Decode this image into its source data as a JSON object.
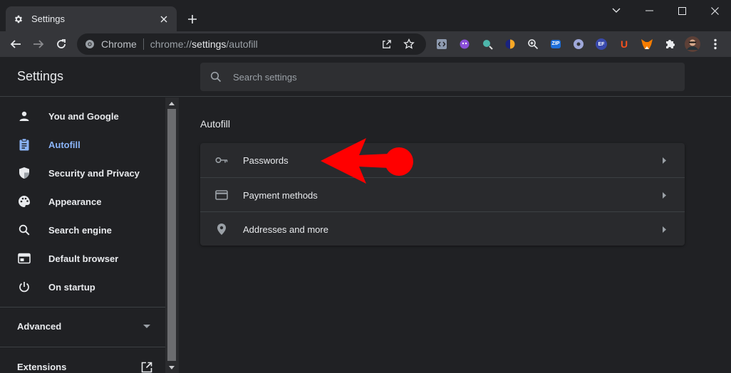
{
  "tab": {
    "title": "Settings"
  },
  "omnibox": {
    "site_label": "Chrome",
    "url_prefix": "chrome://",
    "url_host": "settings",
    "url_path": "/autofill"
  },
  "extensions": [
    {
      "name": "dev-tools-extension-icon",
      "color": "#8e9aaf"
    },
    {
      "name": "purple-monster-extension-icon",
      "color": "#8a4fd8"
    },
    {
      "name": "magnifier-teal-extension-icon",
      "color": "#4db6ac"
    },
    {
      "name": "half-moon-extension-icon",
      "color": "#f9a825"
    },
    {
      "name": "zoom-extension-icon",
      "color": "#e8eaed"
    },
    {
      "name": "zip-extension-icon",
      "color": "#1e6fd9",
      "text": "ZIP"
    },
    {
      "name": "circle-extension-icon",
      "color": "#9fa8da"
    },
    {
      "name": "ef-extension-icon",
      "color": "#3949ab",
      "text": "EF"
    },
    {
      "name": "u-extension-icon",
      "color": "#f4511e",
      "text": "U"
    },
    {
      "name": "fox-extension-icon",
      "color": "#f57c00"
    }
  ],
  "settings": {
    "title": "Settings",
    "search_placeholder": "Search settings"
  },
  "sidebar": {
    "items": [
      {
        "label": "You and Google",
        "icon": "person-icon"
      },
      {
        "label": "Autofill",
        "icon": "clipboard-icon",
        "active": true
      },
      {
        "label": "Security and Privacy",
        "icon": "shield-icon"
      },
      {
        "label": "Appearance",
        "icon": "palette-icon"
      },
      {
        "label": "Search engine",
        "icon": "search-icon"
      },
      {
        "label": "Default browser",
        "icon": "browser-window-icon"
      },
      {
        "label": "On startup",
        "icon": "power-icon"
      }
    ],
    "advanced_label": "Advanced",
    "extensions_label": "Extensions"
  },
  "main": {
    "section_title": "Autofill",
    "rows": [
      {
        "label": "Passwords",
        "icon": "key-icon"
      },
      {
        "label": "Payment methods",
        "icon": "credit-card-icon"
      },
      {
        "label": "Addresses and more",
        "icon": "location-pin-icon"
      }
    ]
  },
  "colors": {
    "accent": "#8ab4f8",
    "annotation_arrow": "#ff0000"
  }
}
